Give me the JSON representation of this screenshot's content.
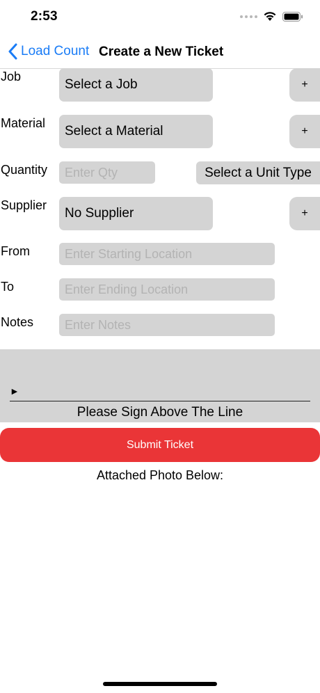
{
  "status_bar": {
    "time": "2:53"
  },
  "nav": {
    "back_label": "Load Count",
    "title": "Create a New Ticket",
    "accent_color": "#1a7cf6"
  },
  "form": {
    "job": {
      "label": "Job",
      "value": "Select a Job",
      "add_label": "+"
    },
    "material": {
      "label": "Material",
      "value": "Select a Material",
      "add_label": "+"
    },
    "quantity": {
      "label": "Quantity",
      "placeholder": "Enter Qty",
      "unit_value": "Select a Unit Type"
    },
    "supplier": {
      "label": "Supplier",
      "value": "No Supplier",
      "add_label": "+"
    },
    "from": {
      "label": "From",
      "placeholder": "Enter Starting Location"
    },
    "to": {
      "label": "To",
      "placeholder": "Enter Ending Location"
    },
    "notes": {
      "label": "Notes",
      "placeholder": "Enter Notes"
    }
  },
  "signature": {
    "marker": "►",
    "caption": "Please Sign Above The Line"
  },
  "submit": {
    "label": "Submit Ticket",
    "color": "#ea3537"
  },
  "photo": {
    "caption": "Attached Photo Below:"
  }
}
